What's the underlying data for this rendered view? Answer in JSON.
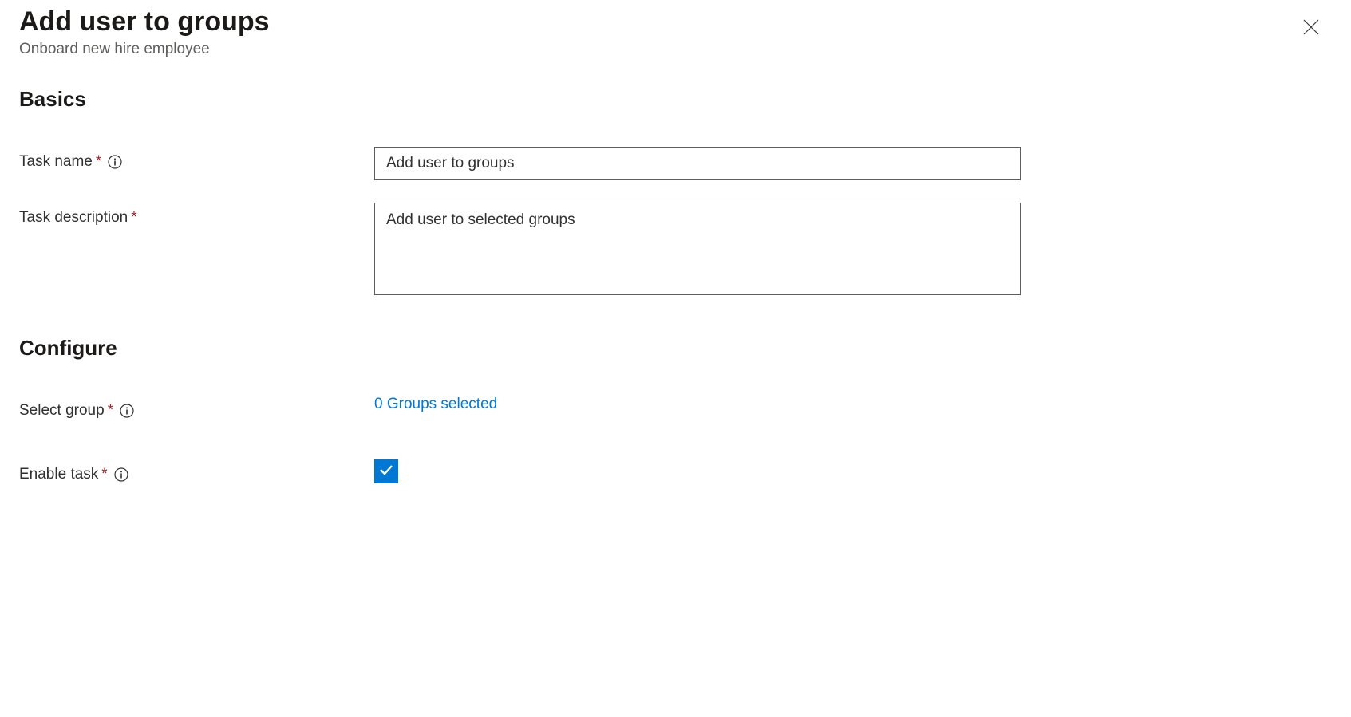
{
  "header": {
    "title": "Add user to groups",
    "subtitle": "Onboard new hire employee"
  },
  "sections": {
    "basics": {
      "heading": "Basics",
      "task_name_label": "Task name",
      "task_name_value": "Add user to groups",
      "task_description_label": "Task description",
      "task_description_value": "Add user to selected groups"
    },
    "configure": {
      "heading": "Configure",
      "select_group_label": "Select group",
      "groups_selected_text": "0 Groups selected",
      "enable_task_label": "Enable task",
      "enable_task_checked": true
    }
  }
}
